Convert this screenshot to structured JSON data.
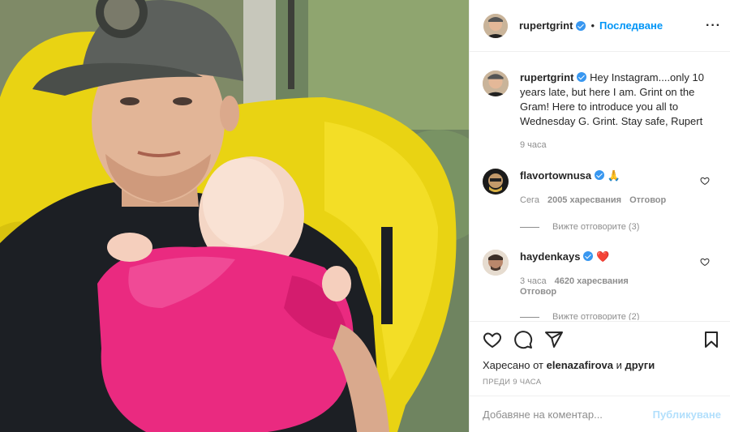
{
  "post": {
    "author": "rupertgrint",
    "follow_label": "Последване",
    "separator": "•",
    "more_label": "···",
    "caption": "Hey Instagram....only 10 years late, but here I am. Grint on the Gram! Here to introduce you all to Wednesday G. Grint. Stay safe, Rupert",
    "caption_time": "9 часа"
  },
  "comments": [
    {
      "user": "flavortownusa",
      "text": "🙏",
      "time": "Сега",
      "likes": "2005 харесвания",
      "reply_label": "Отговор",
      "view_replies": "Вижте отговорите (3)"
    },
    {
      "user": "haydenkays",
      "text": "❤️",
      "time": "3 часа",
      "likes": "4620 харесвания",
      "reply_label": "Отговор",
      "view_replies": "Вижте отговорите (2)"
    }
  ],
  "likes_line": {
    "prefix": "Харесано от",
    "user": "elenazafirova",
    "middle": "и",
    "suffix": "други"
  },
  "timestamp": "ПРЕДИ 9 ЧАСА",
  "comment_box": {
    "placeholder": "Добавяне на коментар...",
    "post_label": "Публикуване"
  },
  "icons": {
    "like": "heart-icon",
    "comment": "comment-icon",
    "share": "paper-plane-icon",
    "save": "bookmark-icon"
  },
  "colors": {
    "accent": "#0095f6",
    "verified": "#3897f0",
    "muted": "#8e8e8e",
    "heart_red": "#ed4956"
  }
}
